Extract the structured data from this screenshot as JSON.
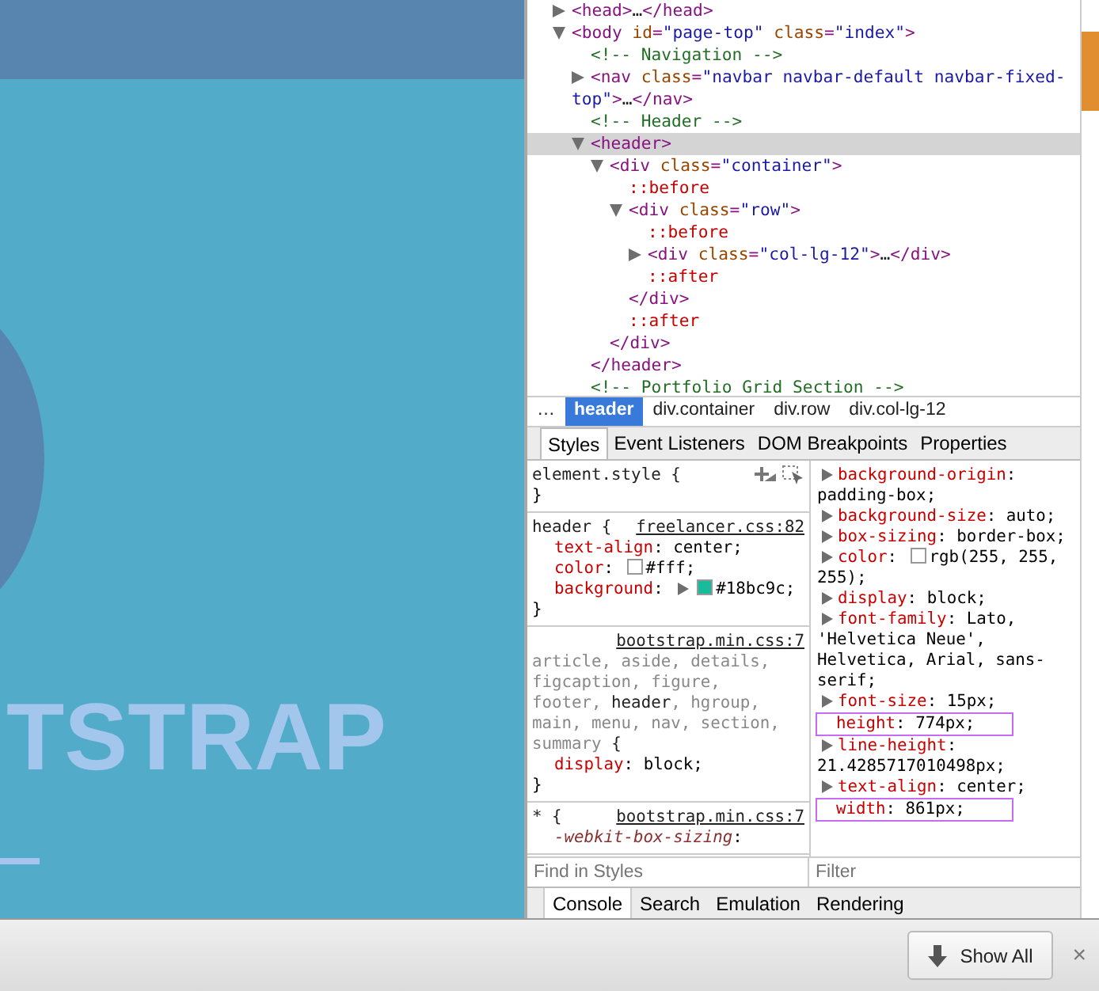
{
  "page": {
    "hero_title": "TSTRAP"
  },
  "dom_tree": [
    {
      "segments": [
        {
          "kind": "tag",
          "text": "<head>"
        },
        {
          "kind": "text",
          "text": "…"
        },
        {
          "kind": "tag",
          "text": "</head>"
        }
      ],
      "expanded": false,
      "selected": false
    },
    {
      "segments": [
        {
          "kind": "tag",
          "text": "<body"
        },
        {
          "kind": "attr",
          "text": " id"
        },
        {
          "kind": "tag",
          "text": "="
        },
        {
          "kind": "value",
          "text": "\"page-top\""
        },
        {
          "kind": "attr",
          "text": " class"
        },
        {
          "kind": "tag",
          "text": "="
        },
        {
          "kind": "value",
          "text": "\"index\""
        },
        {
          "kind": "tag",
          "text": ">"
        }
      ],
      "expanded": true,
      "selected": false,
      "children": [
        {
          "segments": [
            {
              "kind": "comment",
              "text": "<!-- Navigation -->"
            }
          ]
        },
        {
          "segments": [
            {
              "kind": "tag",
              "text": "<nav"
            },
            {
              "kind": "attr",
              "text": " class"
            },
            {
              "kind": "tag",
              "text": "="
            },
            {
              "kind": "value",
              "text": "\"navbar navbar-default navbar-fixed-top\""
            },
            {
              "kind": "tag",
              "text": ">"
            },
            {
              "kind": "text",
              "text": "…"
            },
            {
              "kind": "tag",
              "text": "</nav>"
            }
          ],
          "expanded": false,
          "selected": false
        },
        {
          "segments": [
            {
              "kind": "comment",
              "text": "<!-- Header -->"
            }
          ]
        },
        {
          "segments": [
            {
              "kind": "tag",
              "text": "<header>"
            }
          ],
          "expanded": true,
          "selected": true,
          "children": [
            {
              "segments": [
                {
                  "kind": "tag",
                  "text": "<div"
                },
                {
                  "kind": "attr",
                  "text": " class"
                },
                {
                  "kind": "tag",
                  "text": "="
                },
                {
                  "kind": "value",
                  "text": "\"container\""
                },
                {
                  "kind": "tag",
                  "text": ">"
                }
              ],
              "expanded": true,
              "selected": false,
              "children": [
                {
                  "segments": [
                    {
                      "kind": "pseudo",
                      "text": "::before"
                    }
                  ]
                },
                {
                  "segments": [
                    {
                      "kind": "tag",
                      "text": "<div"
                    },
                    {
                      "kind": "attr",
                      "text": " class"
                    },
                    {
                      "kind": "tag",
                      "text": "="
                    },
                    {
                      "kind": "value",
                      "text": "\"row\""
                    },
                    {
                      "kind": "tag",
                      "text": ">"
                    }
                  ],
                  "expanded": true,
                  "selected": false,
                  "children": [
                    {
                      "segments": [
                        {
                          "kind": "pseudo",
                          "text": "::before"
                        }
                      ]
                    },
                    {
                      "segments": [
                        {
                          "kind": "tag",
                          "text": "<div"
                        },
                        {
                          "kind": "attr",
                          "text": " class"
                        },
                        {
                          "kind": "tag",
                          "text": "="
                        },
                        {
                          "kind": "value",
                          "text": "\"col-lg-12\""
                        },
                        {
                          "kind": "tag",
                          "text": ">"
                        },
                        {
                          "kind": "text",
                          "text": "…"
                        },
                        {
                          "kind": "tag",
                          "text": "</div>"
                        }
                      ],
                      "expanded": false,
                      "selected": false
                    },
                    {
                      "segments": [
                        {
                          "kind": "pseudo",
                          "text": "::after"
                        }
                      ]
                    }
                  ],
                  "close": "</div>"
                },
                {
                  "segments": [
                    {
                      "kind": "pseudo",
                      "text": "::after"
                    }
                  ]
                }
              ],
              "close": "</div>"
            }
          ],
          "close": "</header>"
        },
        {
          "segments": [
            {
              "kind": "comment",
              "text": "<!-- Portfolio Grid Section -->"
            }
          ]
        }
      ]
    }
  ],
  "breadcrumbs": [
    {
      "label": "…",
      "selected": false
    },
    {
      "label": "header",
      "selected": true
    },
    {
      "label": "div.container",
      "selected": false
    },
    {
      "label": "div.row",
      "selected": false
    },
    {
      "label": "div.col-lg-12",
      "selected": false
    }
  ],
  "sidebar_tabs": [
    {
      "label": "Styles",
      "selected": true
    },
    {
      "label": "Event Listeners",
      "selected": false
    },
    {
      "label": "DOM Breakpoints",
      "selected": false
    },
    {
      "label": "Properties",
      "selected": false
    }
  ],
  "style_rules": [
    {
      "kind": "inline",
      "selector": [
        {
          "text": "element.style",
          "matched": true
        }
      ],
      "open_brace": "{",
      "close_brace": "}"
    },
    {
      "kind": "rule",
      "source": "freelancer.css:82",
      "selector": [
        {
          "text": "header",
          "matched": true
        }
      ],
      "open_brace": "{",
      "close_brace": "}",
      "properties": [
        {
          "name": "text-align",
          "separator": ":",
          "value": "center;",
          "overridden": false
        },
        {
          "name": "color",
          "separator": ":",
          "value": "#fff;",
          "color": "#ffffff",
          "overridden": false
        },
        {
          "name": "background",
          "separator": ":",
          "value": "#18bc9c;",
          "color": "#18bc9c",
          "expandable": true,
          "overridden": false
        }
      ]
    },
    {
      "kind": "rule",
      "source": "bootstrap.min.css:7",
      "selector": [
        {
          "text": "article, aside, details, ",
          "matched": false
        },
        {
          "text": "figcaption, figure, ",
          "matched": false
        },
        {
          "text": "footer, ",
          "matched": false
        },
        {
          "text": "header",
          "matched": true
        },
        {
          "text": ", hgroup, ",
          "matched": false
        },
        {
          "text": "main, menu, nav, section, ",
          "matched": false
        },
        {
          "text": "summary",
          "matched": false
        }
      ],
      "open_brace": "{",
      "close_brace": "}",
      "properties": [
        {
          "name": "display",
          "separator": ":",
          "value": "block;",
          "overridden": false
        }
      ]
    },
    {
      "kind": "rule",
      "source": "bootstrap.min.css:7",
      "selector": [
        {
          "text": "*",
          "matched": true
        }
      ],
      "open_brace": "{",
      "properties": [
        {
          "name": "-webkit-box-sizing",
          "separator": ":",
          "overridden": true
        }
      ]
    }
  ],
  "computed": [
    {
      "name": "background-origin",
      "separator": ":",
      "value": "padding-box;",
      "expandable": true,
      "highlighted": false
    },
    {
      "name": "background-size",
      "separator": ":",
      "value": "auto;",
      "expandable": true,
      "highlighted": false
    },
    {
      "name": "box-sizing",
      "separator": ":",
      "value": "border-box;",
      "expandable": true,
      "highlighted": false
    },
    {
      "name": "color",
      "separator": ":",
      "value": "rgb(255, 255, 255);",
      "color": "#ffffff",
      "expandable": true,
      "highlighted": false
    },
    {
      "name": "display",
      "separator": ":",
      "value": "block;",
      "expandable": true,
      "highlighted": false
    },
    {
      "name": "font-family",
      "separator": ":",
      "value": "Lato, 'Helvetica Neue', Helvetica, Arial, sans-serif;",
      "expandable": true,
      "highlighted": false
    },
    {
      "name": "font-size",
      "separator": ":",
      "value": "15px;",
      "expandable": true,
      "highlighted": false
    },
    {
      "name": "height",
      "separator": ":",
      "value": "774px;",
      "expandable": false,
      "highlighted": true
    },
    {
      "name": "line-height",
      "separator": ":",
      "value": "21.4285717010498px;",
      "expandable": true,
      "highlighted": false
    },
    {
      "name": "text-align",
      "separator": ":",
      "value": "center;",
      "expandable": true,
      "highlighted": false
    },
    {
      "name": "width",
      "separator": ":",
      "value": "861px;",
      "expandable": false,
      "highlighted": true
    }
  ],
  "find_styles": {
    "placeholder": "Find in Styles"
  },
  "filter": {
    "placeholder": "Filter"
  },
  "drawer_tabs": [
    {
      "label": "Console",
      "selected": true
    },
    {
      "label": "Search",
      "selected": false
    },
    {
      "label": "Emulation",
      "selected": false
    },
    {
      "label": "Rendering",
      "selected": false
    }
  ],
  "download_bar": {
    "show_all": "Show All",
    "close": "×"
  }
}
